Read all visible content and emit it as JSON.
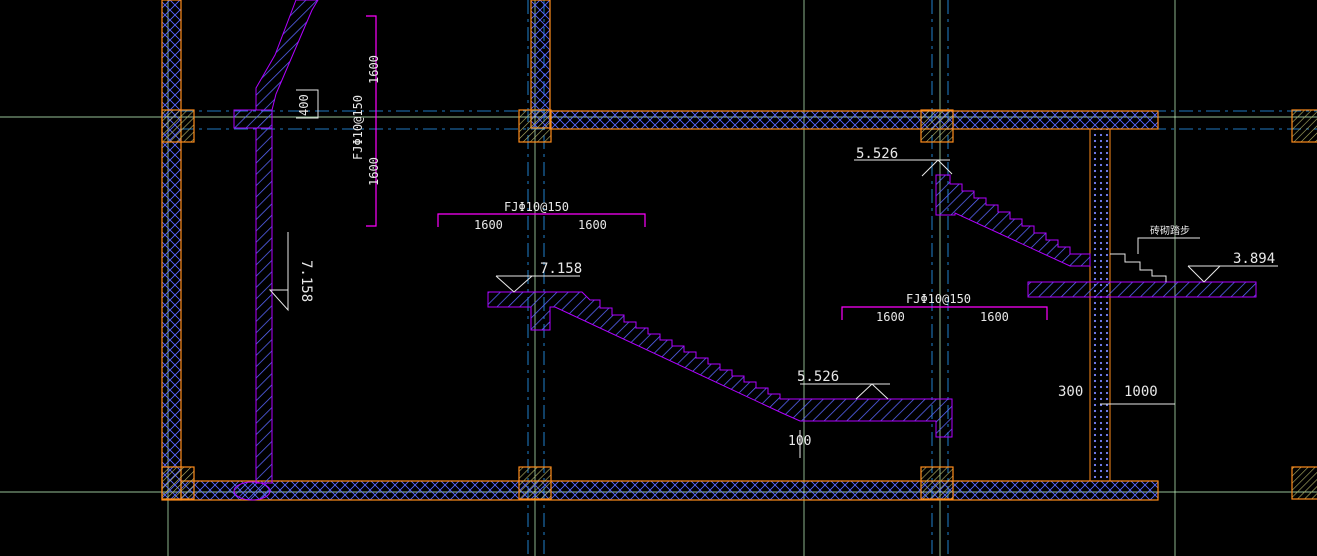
{
  "colors": {
    "background": "#000000",
    "structure_outline": "#ff8c1a",
    "hatch": "#5a67ff",
    "stair_outline": "#b000ff",
    "rebar_line": "#ff00ff",
    "axis_line": "#2aa1ff",
    "grid_line": "#c8ffc8",
    "text": "#e8e8e8",
    "column_fill": "#d4d47a"
  },
  "labels": {
    "rebar_vertical": "FJΦ10@150",
    "rebar_vertical_dim_top": "1600",
    "rebar_vertical_dim_bottom": "1600",
    "rebar_horizontal_left": "FJΦ10@150",
    "rebar_horizontal_left_dim_1": "1600",
    "rebar_horizontal_left_dim_2": "1600",
    "rebar_horizontal_right": "FJΦ10@150",
    "rebar_horizontal_right_dim_1": "1600",
    "rebar_horizontal_right_dim_2": "1600",
    "dim_400": "400",
    "dim_100": "100",
    "dim_300": "300",
    "dim_1000": "1000",
    "elev_left_vertical": "7.158",
    "elev_landing_left": "7.158",
    "elev_landing_mid": "5.526",
    "elev_landing_right_top": "5.526",
    "elev_right": "3.894",
    "note_brick": "砖砌踏步"
  }
}
